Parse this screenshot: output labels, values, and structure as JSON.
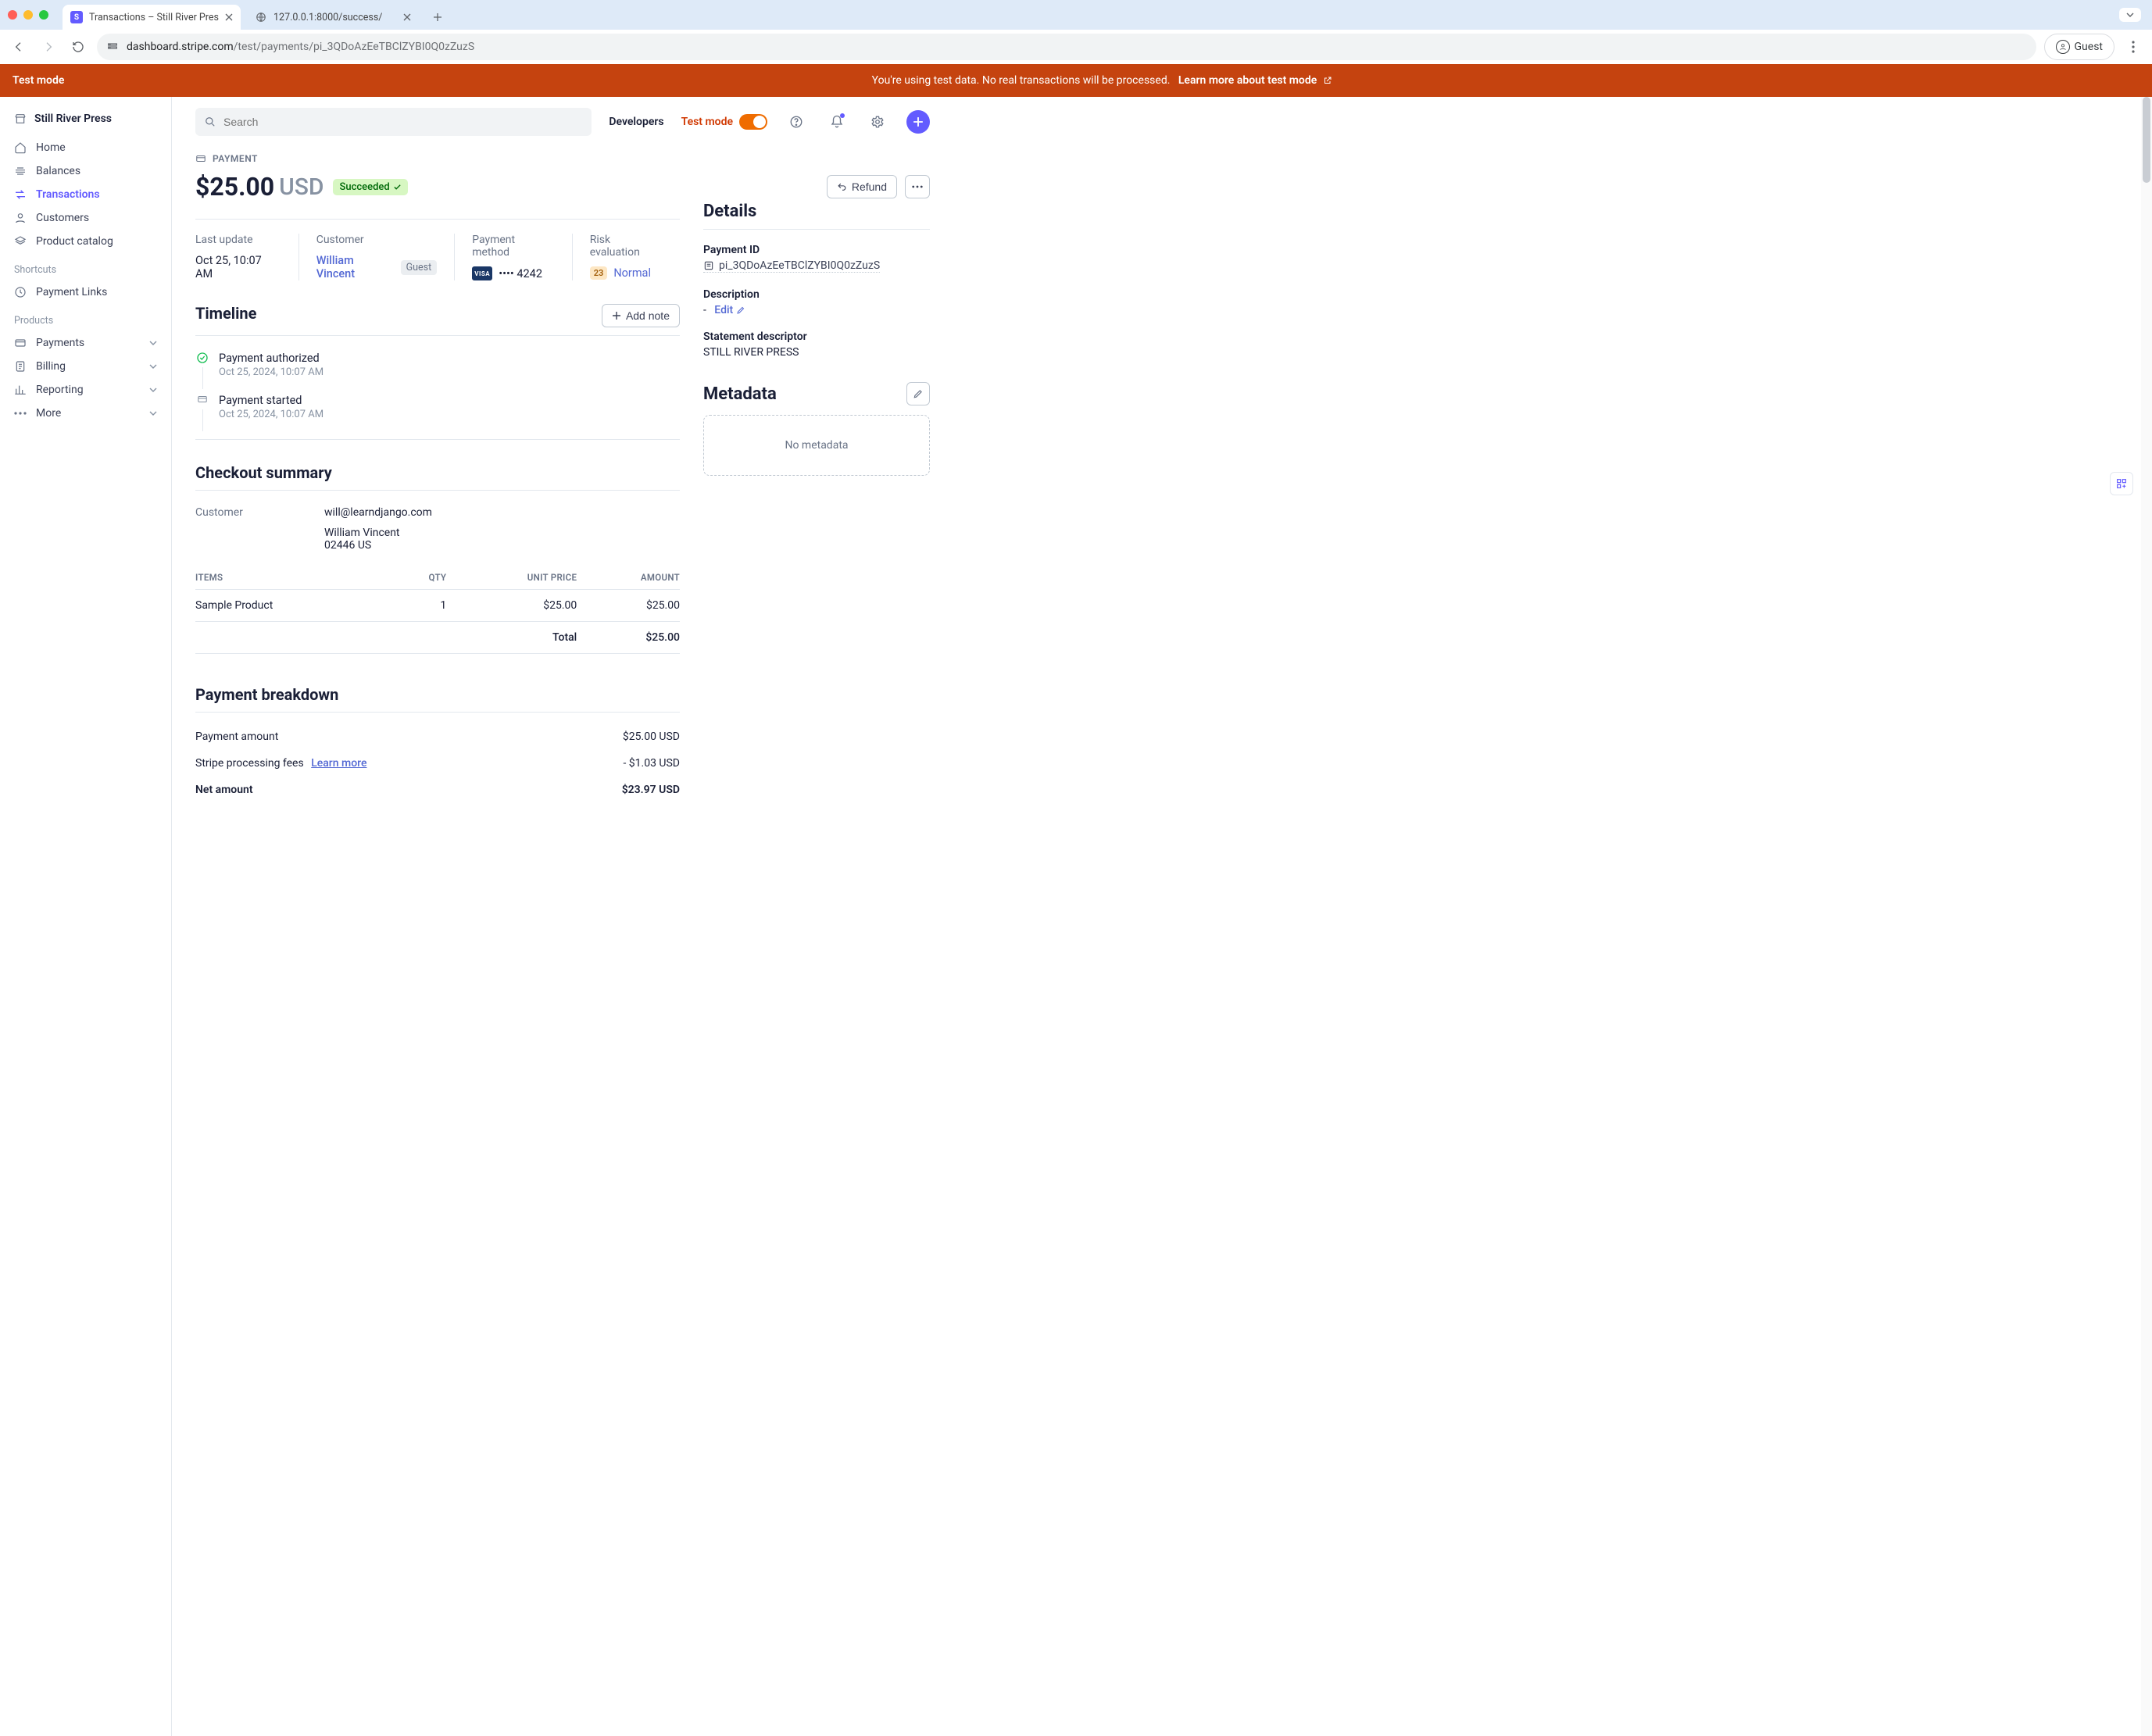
{
  "browser": {
    "tabs": [
      {
        "title": "Transactions – Still River Pres",
        "favicon": "S"
      },
      {
        "title": "127.0.0.1:8000/success/"
      }
    ],
    "url": {
      "host": "dashboard.stripe.com",
      "path": "/test/payments/pi_3QDoAzEeTBClZYBI0Q0zZuzS"
    },
    "guest_label": "Guest"
  },
  "banner": {
    "left": "Test mode",
    "msg": "You're using test data. No real transactions will be processed.",
    "learn": "Learn more about test mode"
  },
  "sidebar": {
    "org": "Still River Press",
    "nav": [
      "Home",
      "Balances",
      "Transactions",
      "Customers",
      "Product catalog"
    ],
    "active": "Transactions",
    "shortcuts_label": "Shortcuts",
    "shortcuts": [
      "Payment Links"
    ],
    "products_label": "Products",
    "products": [
      "Payments",
      "Billing",
      "Reporting",
      "More"
    ]
  },
  "topbar": {
    "search_placeholder": "Search",
    "developers": "Developers",
    "testmode": "Test mode"
  },
  "header": {
    "crumb": "PAYMENT",
    "amount": "$25.00",
    "currency": "USD",
    "status": "Succeeded",
    "refund_btn": "Refund"
  },
  "kv": {
    "last_update": {
      "label": "Last update",
      "value": "Oct 25, 10:07 AM"
    },
    "customer": {
      "label": "Customer",
      "name": "William Vincent",
      "chip": "Guest"
    },
    "payment_method": {
      "label": "Payment method",
      "brand": "VISA",
      "last4": "•••• 4242"
    },
    "risk": {
      "label": "Risk evaluation",
      "score": "23",
      "text": "Normal"
    }
  },
  "timeline": {
    "title": "Timeline",
    "add_note": "Add note",
    "items": [
      {
        "title": "Payment authorized",
        "time": "Oct 25, 2024, 10:07 AM",
        "state": "ok"
      },
      {
        "title": "Payment started",
        "time": "Oct 25, 2024, 10:07 AM",
        "state": "muted"
      }
    ]
  },
  "checkout": {
    "title": "Checkout summary",
    "customer_label": "Customer",
    "customer_email": "will@learndjango.com",
    "customer_name": "William Vincent",
    "customer_addr": "02446 US",
    "cols": {
      "items": "ITEMS",
      "qty": "QTY",
      "unit": "UNIT PRICE",
      "amount": "AMOUNT"
    },
    "rows": [
      {
        "item": "Sample Product",
        "qty": "1",
        "unit": "$25.00",
        "amount": "$25.00"
      }
    ],
    "total_label": "Total",
    "total": "$25.00"
  },
  "breakdown": {
    "title": "Payment breakdown",
    "rows": {
      "payment": {
        "label": "Payment amount",
        "value": "$25.00 USD"
      },
      "fees": {
        "label": "Stripe processing fees",
        "learn": "Learn more",
        "value": "- $1.03 USD"
      },
      "net": {
        "label": "Net amount",
        "value": "$23.97 USD"
      }
    }
  },
  "details": {
    "title": "Details",
    "payment_id_label": "Payment ID",
    "payment_id": "pi_3QDoAzEeTBClZYBI0Q0zZuzS",
    "description_label": "Description",
    "description_dash": "-",
    "edit": "Edit",
    "descriptor_label": "Statement descriptor",
    "descriptor": "STILL RIVER PRESS",
    "metadata_title": "Metadata",
    "no_metadata": "No metadata"
  }
}
